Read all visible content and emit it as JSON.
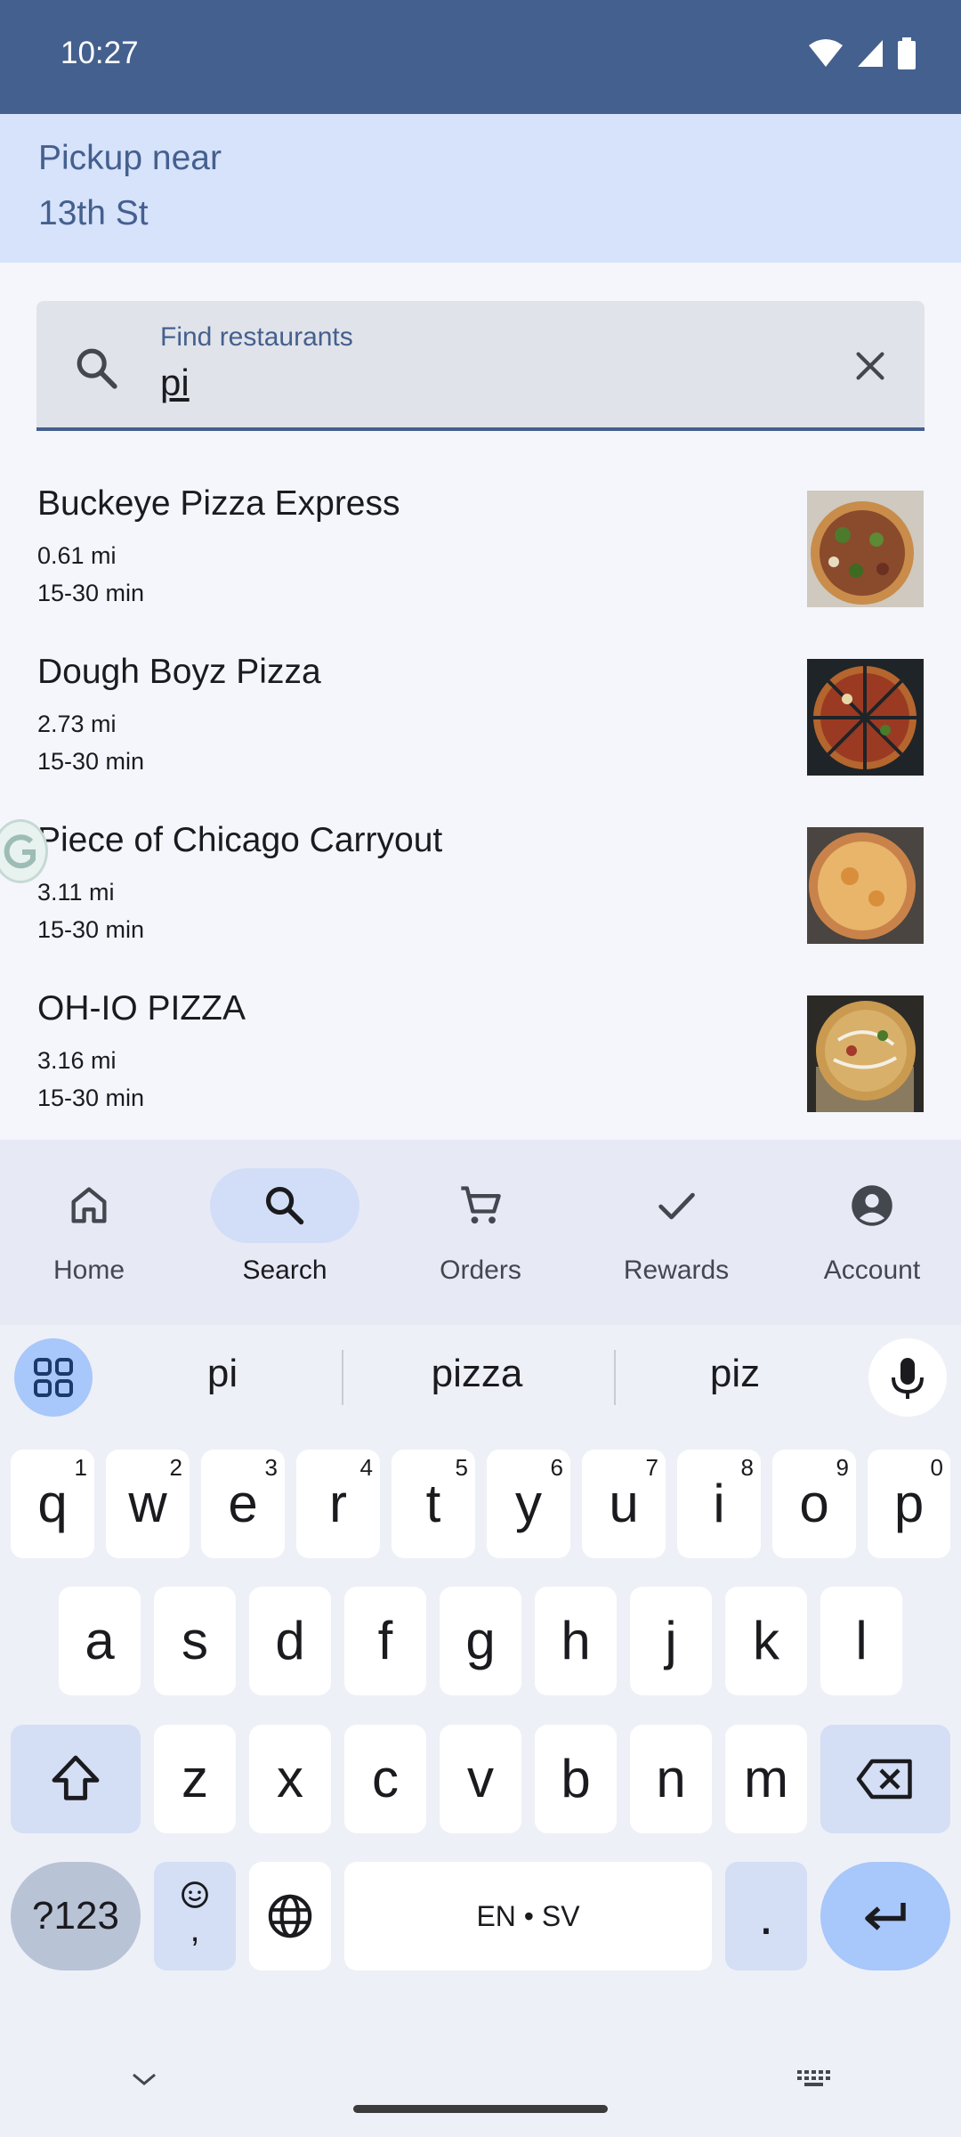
{
  "status_bar": {
    "time": "10:27"
  },
  "pickup": {
    "line1": "Pickup near",
    "line2": "13th St"
  },
  "search": {
    "label": "Find restaurants",
    "value": "pi"
  },
  "results": [
    {
      "name": "Buckeye Pizza Express",
      "distance": "0.61 mi",
      "time": "15-30 min"
    },
    {
      "name": "Dough Boyz Pizza",
      "distance": "2.73 mi",
      "time": "15-30 min"
    },
    {
      "name": "Piece of Chicago Carryout",
      "distance": "3.11 mi",
      "time": "15-30 min"
    },
    {
      "name": "OH-IO PIZZA",
      "distance": "3.16 mi",
      "time": "15-30 min"
    }
  ],
  "bottom_nav": [
    {
      "label": "Home",
      "icon": "home-icon",
      "active": false
    },
    {
      "label": "Search",
      "icon": "search-icon",
      "active": true
    },
    {
      "label": "Orders",
      "icon": "cart-icon",
      "active": false
    },
    {
      "label": "Rewards",
      "icon": "check-icon",
      "active": false
    },
    {
      "label": "Account",
      "icon": "account-icon",
      "active": false
    }
  ],
  "keyboard": {
    "suggestions": [
      "pi",
      "pizza",
      "piz"
    ],
    "row1": [
      {
        "k": "q",
        "n": "1"
      },
      {
        "k": "w",
        "n": "2"
      },
      {
        "k": "e",
        "n": "3"
      },
      {
        "k": "r",
        "n": "4"
      },
      {
        "k": "t",
        "n": "5"
      },
      {
        "k": "y",
        "n": "6"
      },
      {
        "k": "u",
        "n": "7"
      },
      {
        "k": "i",
        "n": "8"
      },
      {
        "k": "o",
        "n": "9"
      },
      {
        "k": "p",
        "n": "0"
      }
    ],
    "row2": [
      "a",
      "s",
      "d",
      "f",
      "g",
      "h",
      "j",
      "k",
      "l"
    ],
    "row3": [
      "z",
      "x",
      "c",
      "v",
      "b",
      "n",
      "m"
    ],
    "symbols_label": "?123",
    "emoji_comma": ",",
    "space_label": "EN • SV",
    "period": "."
  }
}
